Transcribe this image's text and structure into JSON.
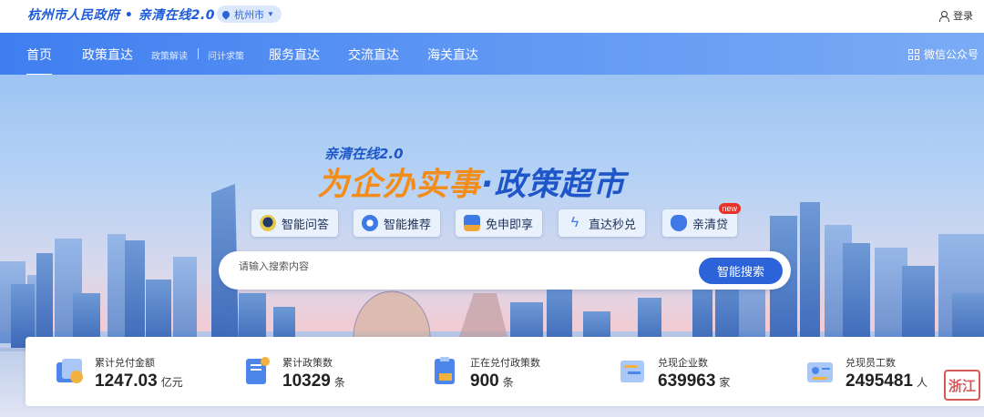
{
  "header": {
    "logo_text": "杭州市人民政府 • 亲清在线2.0",
    "city": "杭州市",
    "login_label": "登录"
  },
  "nav": {
    "items": [
      "首页",
      "政策直达",
      "服务直达",
      "交流直达",
      "海关直达"
    ],
    "sub_items": [
      "政策解读",
      "问计求策"
    ],
    "wechat_label": "微信公众号"
  },
  "hero": {
    "slogan_small": "亲清在线2.0",
    "slogan_warm": "为企办实事",
    "slogan_dot": "·",
    "slogan_blue": "政策超市"
  },
  "quick_entries": [
    {
      "label": "智能问答",
      "icon": "robot-icon"
    },
    {
      "label": "智能推荐",
      "icon": "gear-icon"
    },
    {
      "label": "免申即享",
      "icon": "user-badge-icon"
    },
    {
      "label": "直达秒兑",
      "icon": "lightning-icon"
    },
    {
      "label": "亲清贷",
      "icon": "money-bag-icon",
      "badge": "new"
    }
  ],
  "search": {
    "placeholder": "请输入搜索内容",
    "button_label": "智能搜索"
  },
  "stats": [
    {
      "label": "累计兑付金额",
      "value": "1247.03",
      "unit": "亿元",
      "icon": "coin-icon"
    },
    {
      "label": "累计政策数",
      "value": "10329",
      "unit": "条",
      "icon": "document-icon"
    },
    {
      "label": "正在兑付政策数",
      "value": "900",
      "unit": "条",
      "icon": "clipboard-icon"
    },
    {
      "label": "兑现企业数",
      "value": "639963",
      "unit": "家",
      "icon": "enterprise-icon"
    },
    {
      "label": "兑现员工数",
      "value": "2495481",
      "unit": "人",
      "icon": "staff-card-icon"
    }
  ],
  "watermark": "浙江",
  "colors": {
    "brand_blue": "#2c63d8",
    "slogan_orange": "#f28c1a",
    "badge_red": "#e8332a"
  }
}
